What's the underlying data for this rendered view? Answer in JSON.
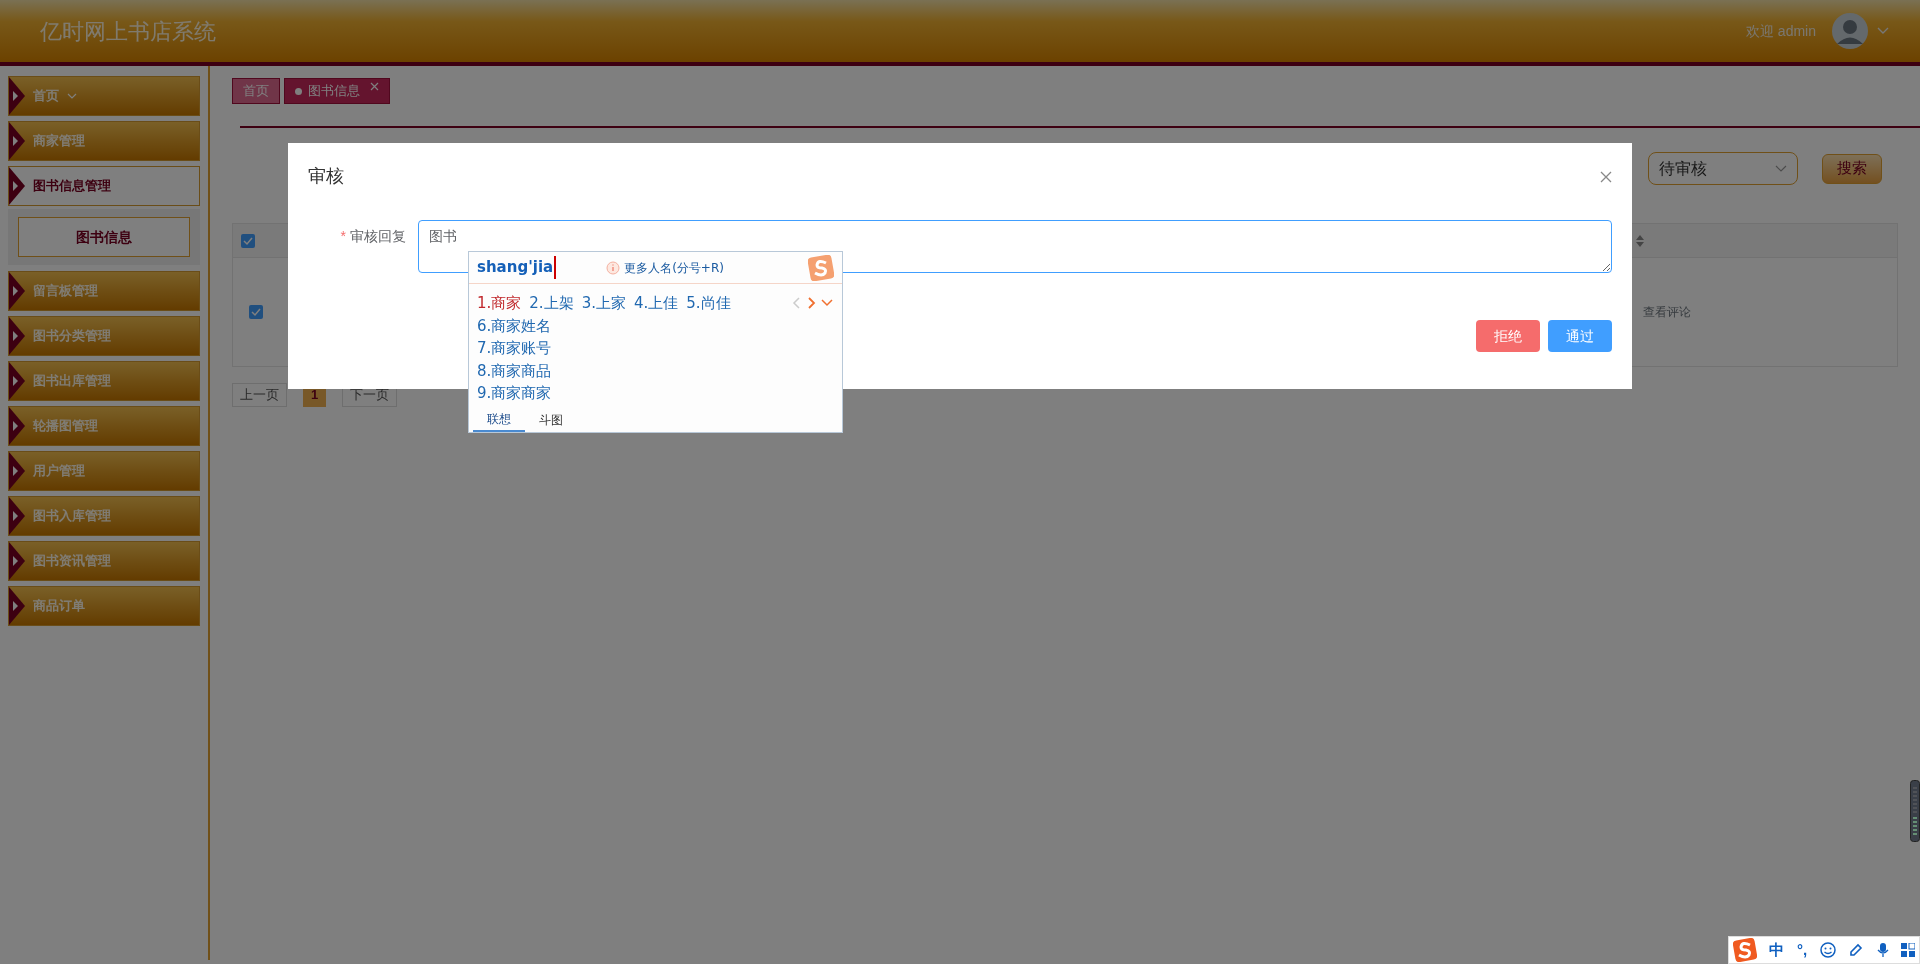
{
  "header": {
    "title": "亿时网上书店系统",
    "welcome": "欢迎 admin"
  },
  "sidebar": {
    "items": [
      {
        "label": "首页",
        "dropdown": true,
        "selected": false
      },
      {
        "label": "商家管理",
        "dropdown": false,
        "selected": false
      },
      {
        "label": "图书信息管理",
        "dropdown": false,
        "selected": true,
        "children": [
          {
            "label": "图书信息",
            "selected": true
          }
        ]
      },
      {
        "label": "留言板管理",
        "dropdown": false,
        "selected": false
      },
      {
        "label": "图书分类管理",
        "dropdown": false,
        "selected": false
      },
      {
        "label": "图书出库管理",
        "dropdown": false,
        "selected": false
      },
      {
        "label": "轮播图管理",
        "dropdown": false,
        "selected": false
      },
      {
        "label": "用户管理",
        "dropdown": false,
        "selected": false
      },
      {
        "label": "图书入库管理",
        "dropdown": false,
        "selected": false
      },
      {
        "label": "图书资讯管理",
        "dropdown": false,
        "selected": false
      },
      {
        "label": "商品订单",
        "dropdown": false,
        "selected": false
      }
    ]
  },
  "tabs": [
    {
      "label": "首页",
      "selected": false,
      "closable": false
    },
    {
      "label": "图书信息",
      "selected": true,
      "closable": true
    }
  ],
  "filter": {
    "status": "待审核",
    "search_button": "搜索"
  },
  "table": {
    "header_checked": true,
    "rows": [
      {
        "checked": true,
        "action": "查看评论"
      }
    ]
  },
  "pagination": {
    "prev": "上一页",
    "pages": [
      {
        "label": "1",
        "selected": true
      }
    ],
    "next": "下一页"
  },
  "dialog": {
    "title": "审核",
    "field": {
      "required_mark": "*",
      "label": "审核回复",
      "value": "图书"
    },
    "buttons": [
      {
        "label": "拒绝",
        "kind": "danger"
      },
      {
        "label": "通过",
        "kind": "primary"
      }
    ]
  },
  "ime": {
    "composition": "shang'jia",
    "hint": "更多人名(分号+R)",
    "candidates": [
      {
        "label": "1.商家",
        "selected": true
      },
      {
        "label": "2.上架",
        "selected": false
      },
      {
        "label": "3.上家",
        "selected": false
      },
      {
        "label": "4.上佳",
        "selected": false
      },
      {
        "label": "5.尚佳",
        "selected": false
      }
    ],
    "more_candidates": [
      "6.商家姓名",
      "7.商家账号",
      "8.商家商品",
      "9.商家商家"
    ],
    "tabs": [
      {
        "label": "联想",
        "selected": true
      },
      {
        "label": "斗图",
        "selected": false
      }
    ]
  },
  "ime_toolbar": {
    "mode": "中",
    "punctuation": "°,"
  }
}
